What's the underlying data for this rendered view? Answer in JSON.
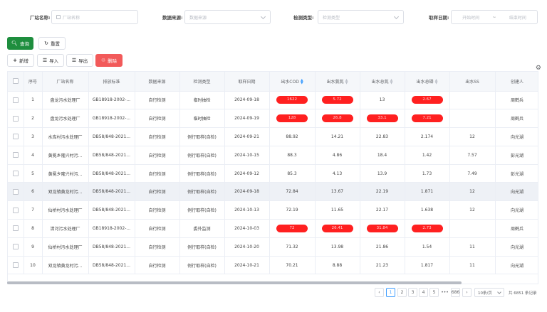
{
  "filters": {
    "factory_label": "厂站名称:",
    "factory_placeholder": "厂站名称",
    "source_label": "数据来源:",
    "source_placeholder": "数据来源",
    "type_label": "检测类型:",
    "type_placeholder": "检测类型",
    "date_label": "取样日期:",
    "date_start_placeholder": "开始时间",
    "date_sep": "~",
    "date_end_placeholder": "结束时间"
  },
  "actions": {
    "search": "查询",
    "reset": "重置",
    "add": "新增",
    "import": "导入",
    "export": "导出",
    "delete": "删除"
  },
  "table": {
    "headers": [
      "序号",
      "厂站名称",
      "排放标准",
      "数据来源",
      "检测类型",
      "取样日期",
      "出水COD",
      "出水氨氮",
      "出水总氮",
      "出水总磷",
      "出水SS",
      "创建人"
    ],
    "rows": [
      {
        "no": "1",
        "name": "盘龙污水处理厂",
        "std": "GB18918-2002-...",
        "source": "自行检测",
        "type": "临时抽检",
        "date": "2024-09-18",
        "cod": "1622",
        "nh": "5.72",
        "tn": "13",
        "tp": "2.67",
        "ss": "",
        "creator": "周鹤兵",
        "cod_alert": true,
        "nh_alert": true,
        "tn_alert": false,
        "tp_alert": true
      },
      {
        "no": "2",
        "name": "盘龙污水处理厂",
        "std": "GB18918-2002-...",
        "source": "自行检测",
        "type": "临时抽检",
        "date": "2024-09-19",
        "cod": "128",
        "nh": "26.8",
        "tn": "33.1",
        "tp": "7.21",
        "ss": "",
        "creator": "周鹤兵",
        "cod_alert": true,
        "nh_alert": true,
        "tn_alert": true,
        "tp_alert": true
      },
      {
        "no": "3",
        "name": "水库村污水处理厂",
        "std": "DB58/848-2021...",
        "source": "自行检测",
        "type": "例行取样(自检)",
        "date": "2024-09-21",
        "cod": "88.92",
        "nh": "14.21",
        "tn": "22.83",
        "tp": "2.174",
        "ss": "12",
        "creator": "向光湖",
        "cod_alert": false,
        "nh_alert": false,
        "tn_alert": false,
        "tp_alert": false
      },
      {
        "no": "4",
        "name": "黄冕乡隆兴村污...",
        "std": "DB58/848-2021...",
        "source": "自行检测",
        "type": "例行取样(自检)",
        "date": "2024-10-15",
        "cod": "88.3",
        "nh": "4.86",
        "tn": "18.4",
        "tp": "1.42",
        "ss": "7.57",
        "creator": "彭光湖",
        "cod_alert": false,
        "nh_alert": false,
        "tn_alert": false,
        "tp_alert": false
      },
      {
        "no": "5",
        "name": "黄冕乡隆兴村污...",
        "std": "DB58/848-2021...",
        "source": "自行检测",
        "type": "例行取样(自检)",
        "date": "2024-09-12",
        "cod": "85.3",
        "nh": "4.13",
        "tn": "13.9",
        "tp": "1.73",
        "ss": "7.49",
        "creator": "彭光湖",
        "cod_alert": false,
        "nh_alert": false,
        "tn_alert": false,
        "tp_alert": false
      },
      {
        "no": "6",
        "name": "双龙镇黄龙村污...",
        "std": "DB58/848-2021...",
        "source": "自行检测",
        "type": "例行取样(自检)",
        "date": "2024-09-18",
        "cod": "72.84",
        "nh": "13.67",
        "tn": "22.19",
        "tp": "1.871",
        "ss": "12",
        "creator": "向光湖",
        "cod_alert": false,
        "nh_alert": false,
        "tn_alert": false,
        "tp_alert": false
      },
      {
        "no": "7",
        "name": "仙桥村污水处理厂",
        "std": "DB58/848-2021...",
        "source": "自行检测",
        "type": "例行取样(自检)",
        "date": "2024-10-13",
        "cod": "72.19",
        "nh": "11.65",
        "tn": "22.17",
        "tp": "1.638",
        "ss": "12",
        "creator": "向光湖",
        "cod_alert": false,
        "nh_alert": false,
        "tn_alert": false,
        "tp_alert": false
      },
      {
        "no": "8",
        "name": "清河污水处理厂",
        "std": "GB18918-2002-...",
        "source": "自行检测",
        "type": "委外监测",
        "date": "2024-10-03",
        "cod": "72",
        "nh": "26.41",
        "tn": "31.84",
        "tp": "2.73",
        "ss": "",
        "creator": "周鹤兵",
        "cod_alert": true,
        "nh_alert": true,
        "tn_alert": true,
        "tp_alert": true
      },
      {
        "no": "9",
        "name": "仙桥村污水处理厂",
        "std": "DB58/848-2021...",
        "source": "自行检测",
        "type": "例行取样(自检)",
        "date": "2024-10-20",
        "cod": "71.32",
        "nh": "13.98",
        "tn": "21.86",
        "tp": "1.54",
        "ss": "11",
        "creator": "向光湖",
        "cod_alert": false,
        "nh_alert": false,
        "tn_alert": false,
        "tp_alert": false
      },
      {
        "no": "10",
        "name": "双龙镇黄龙村污...",
        "std": "DB58/848-2021...",
        "source": "自行检测",
        "type": "例行取样(自检)",
        "date": "2024-10-21",
        "cod": "70.21",
        "nh": "8.88",
        "tn": "21.23",
        "tp": "1.817",
        "ss": "11",
        "creator": "向光湖",
        "cod_alert": false,
        "nh_alert": false,
        "tn_alert": false,
        "tp_alert": false
      }
    ]
  },
  "pagination": {
    "pages": [
      "1",
      "2",
      "3",
      "4",
      "5"
    ],
    "ellipsis": "•••",
    "last": "686",
    "page_size": "10条/页",
    "total": "共 6851 条记录",
    "current": "1"
  },
  "colors": {
    "primary_green": "#1e8e3e",
    "alert_red": "#ff2020",
    "delete_red": "#f25a5a",
    "active_blue": "#409eff"
  },
  "icons": [
    "search-icon",
    "refresh-icon",
    "plus-icon",
    "import-icon",
    "export-icon",
    "trash-icon",
    "gear-icon",
    "sort-icon",
    "chevron-left-icon",
    "chevron-right-icon",
    "calendar-icon"
  ]
}
